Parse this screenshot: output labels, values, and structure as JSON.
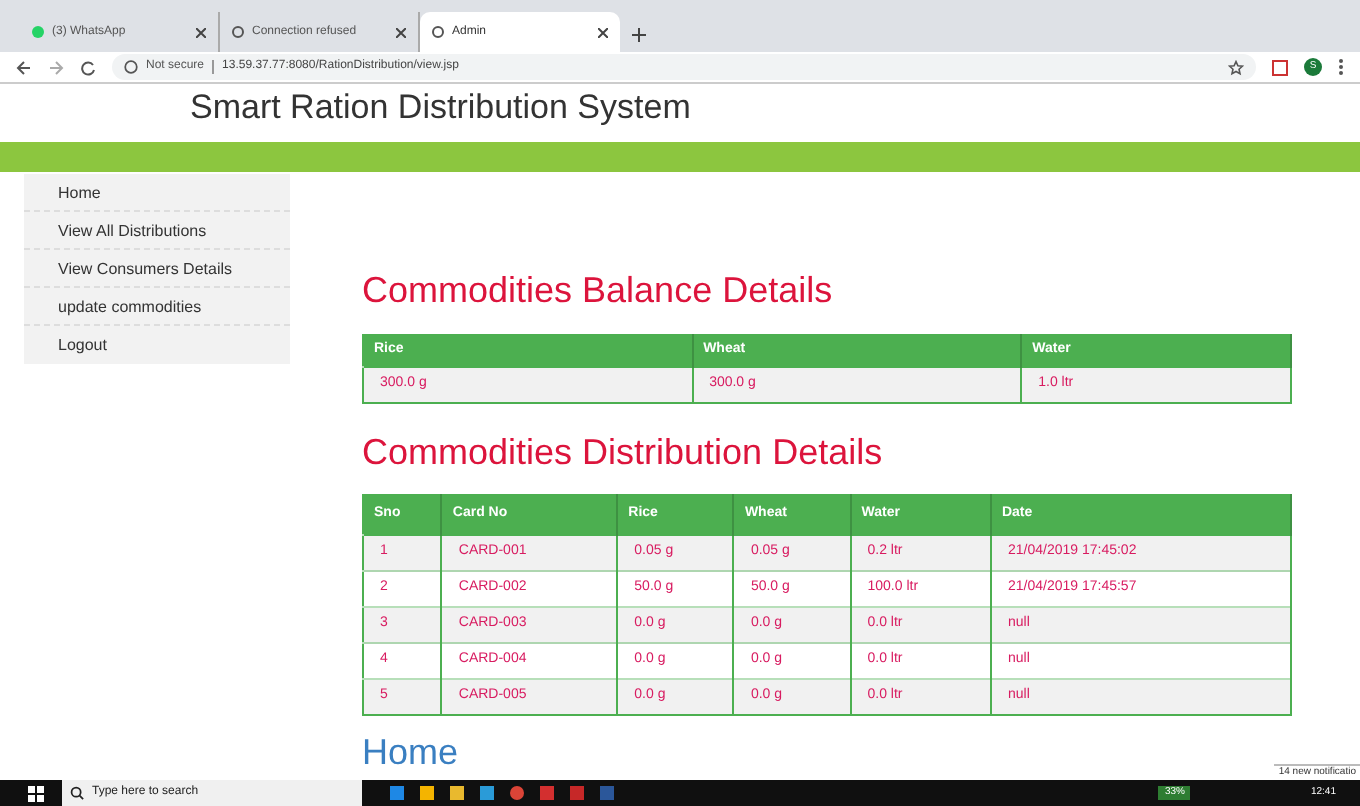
{
  "browser": {
    "tabs": [
      {
        "label": "(3) WhatsApp",
        "selected": false
      },
      {
        "label": "Connection refused",
        "selected": false
      },
      {
        "label": "Admin",
        "selected": true
      }
    ],
    "security": "Not secure",
    "url": "13.59.37.77:8080/RationDistribution/view.jsp",
    "profile": "S"
  },
  "site_title": "Smart Ration Distribution System",
  "sidebar": {
    "items": [
      {
        "label": "Home"
      },
      {
        "label": "View All Distributions"
      },
      {
        "label": "View Consumers Details"
      },
      {
        "label": "update commodities"
      },
      {
        "label": "Logout"
      }
    ]
  },
  "balance": {
    "heading": "Commodities Balance Details",
    "columns": [
      "Rice",
      "Wheat",
      "Water"
    ],
    "rows": [
      [
        "300.0 g",
        "300.0 g",
        "1.0 ltr"
      ]
    ]
  },
  "distribution": {
    "heading": "Commodities Distribution Details",
    "columns": [
      "Sno",
      "Card No",
      "Rice",
      "Wheat",
      "Water",
      "Date"
    ],
    "rows": [
      [
        "1",
        "CARD-001",
        "0.05 g",
        "0.05 g",
        "0.2 ltr",
        "21/04/2019 17:45:02"
      ],
      [
        "2",
        "CARD-002",
        "50.0 g",
        "50.0 g",
        "100.0 ltr",
        "21/04/2019 17:45:57"
      ],
      [
        "3",
        "CARD-003",
        "0.0 g",
        "0.0 g",
        "0.0 ltr",
        "null"
      ],
      [
        "4",
        "CARD-004",
        "0.0 g",
        "0.0 g",
        "0.0 ltr",
        "null"
      ],
      [
        "5",
        "CARD-005",
        "0.0 g",
        "0.0 g",
        "0.0 ltr",
        "null"
      ]
    ]
  },
  "next_heading": "Home",
  "taskbar": {
    "search_placeholder": "Type here to search",
    "battery": "33%",
    "time": "12:41",
    "notification": "14 new notificatio"
  }
}
